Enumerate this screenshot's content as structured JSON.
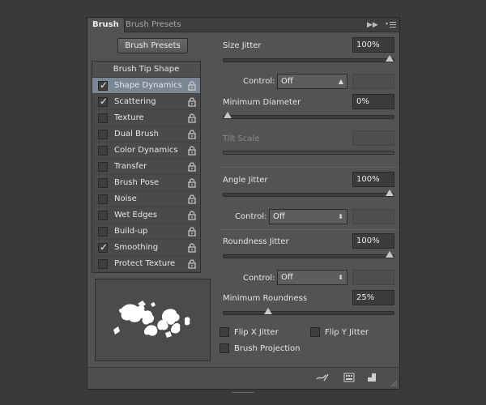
{
  "tabs": [
    {
      "label": "Brush",
      "active": true
    },
    {
      "label": "Brush Presets",
      "active": false
    }
  ],
  "presets_button": "Brush Presets",
  "brush_tip_shape": "Brush Tip Shape",
  "settings_list": [
    {
      "label": "Shape Dynamics",
      "checked": true,
      "selected": true
    },
    {
      "label": "Scattering",
      "checked": true
    },
    {
      "label": "Texture",
      "checked": false
    },
    {
      "label": "Dual Brush",
      "checked": false
    },
    {
      "label": "Color Dynamics",
      "checked": false
    },
    {
      "label": "Transfer",
      "checked": false
    },
    {
      "label": "Brush Pose",
      "checked": false
    },
    {
      "label": "Noise",
      "checked": false
    },
    {
      "label": "Wet Edges",
      "checked": false
    },
    {
      "label": "Build-up",
      "checked": false
    },
    {
      "label": "Smoothing",
      "checked": true
    },
    {
      "label": "Protect Texture",
      "checked": false
    }
  ],
  "check_glyph": "✓",
  "size_jitter": {
    "label": "Size Jitter",
    "value": "100%",
    "level": 1.0
  },
  "control_1": {
    "label": "Control:",
    "value": "Off"
  },
  "minimum_diameter": {
    "label": "Minimum Diameter",
    "value": "0%",
    "level": 0.0
  },
  "tilt_scale": {
    "label": "Tilt Scale",
    "value": ""
  },
  "angle_jitter": {
    "label": "Angle Jitter",
    "value": "100%",
    "level": 1.0
  },
  "control_2": {
    "label": "Control:",
    "value": "Off"
  },
  "roundness_jitter": {
    "label": "Roundness Jitter",
    "value": "100%",
    "level": 1.0
  },
  "control_3": {
    "label": "Control:",
    "value": "Off"
  },
  "minimum_roundness": {
    "label": "Minimum Roundness",
    "value": "25%",
    "level": 0.25
  },
  "flip_x": {
    "label": "Flip X Jitter",
    "checked": false
  },
  "flip_y": {
    "label": "Flip Y Jitter",
    "checked": false
  },
  "brush_projection": {
    "label": "Brush Projection",
    "checked": false
  },
  "colors": {
    "accent_selected": "#7a8694",
    "panel": "#535353"
  },
  "icons": [
    "panel-menu-icon",
    "collapse-icon",
    "lock-icon",
    "brush-toggle-icon",
    "brush-grid-icon",
    "new-preset-icon"
  ]
}
